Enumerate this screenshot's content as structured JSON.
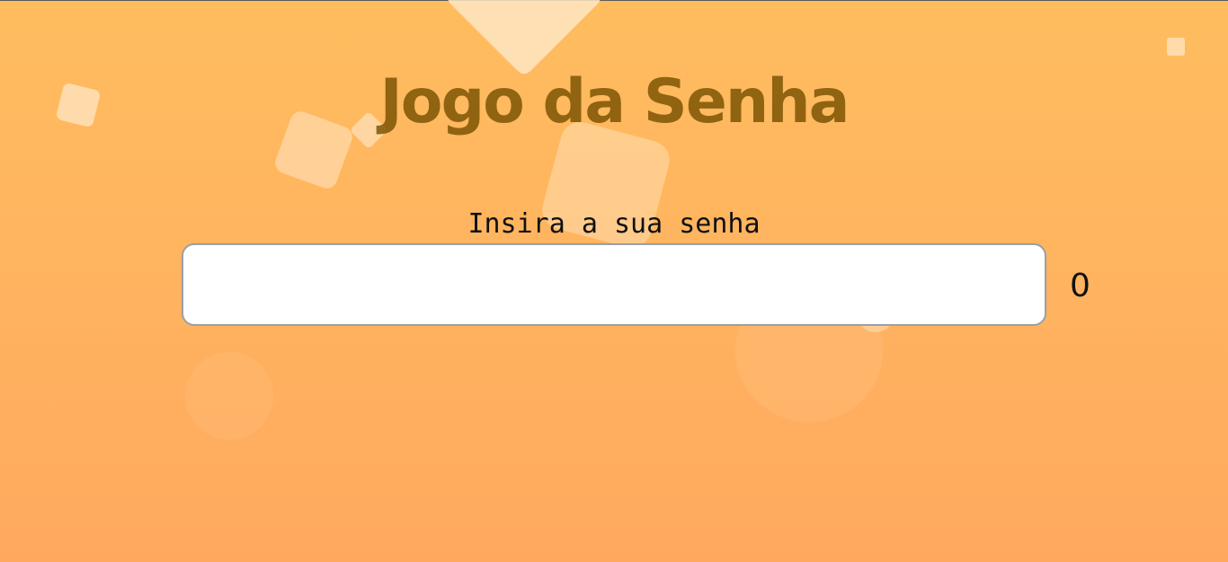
{
  "page": {
    "title": "Jogo da Senha",
    "password_label": "Insira a sua senha",
    "password_value": "",
    "length_counter": "0"
  },
  "colors": {
    "background_top": "#ffbd5f",
    "background_bottom": "#ffa95f",
    "title": "#785000",
    "decoration": "#ffe6c4"
  }
}
